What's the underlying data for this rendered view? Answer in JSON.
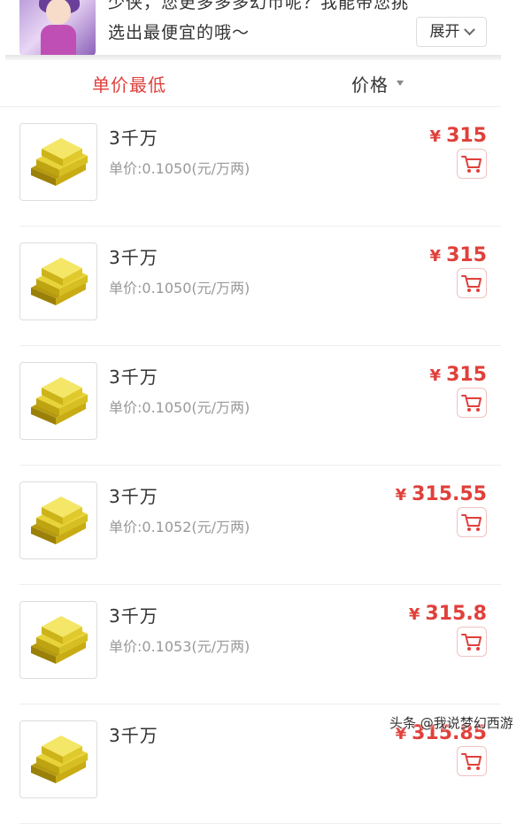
{
  "banner": {
    "text": "少侠，您更多多多幻币呢？我能带您挑选出最便宜的哦～",
    "expand_label": "展开"
  },
  "sort": {
    "lowest_unit_price_label": "单价最低",
    "price_label": "价格"
  },
  "items": [
    {
      "name": "3千万",
      "unit_price": "单价:0.1050(元/万两)",
      "currency": "¥",
      "price": "315"
    },
    {
      "name": "3千万",
      "unit_price": "单价:0.1050(元/万两)",
      "currency": "¥",
      "price": "315"
    },
    {
      "name": "3千万",
      "unit_price": "单价:0.1050(元/万两)",
      "currency": "¥",
      "price": "315"
    },
    {
      "name": "3千万",
      "unit_price": "单价:0.1052(元/万两)",
      "currency": "¥",
      "price": "315.55"
    },
    {
      "name": "3千万",
      "unit_price": "单价:0.1053(元/万两)",
      "currency": "¥",
      "price": "315.8"
    },
    {
      "name": "3千万",
      "unit_price": "",
      "currency": "¥",
      "price": "315.85"
    }
  ],
  "watermark": "头条 @我说梦幻西游",
  "colors": {
    "accent": "#e0403b",
    "muted": "#999999",
    "gold": "#d8c020"
  }
}
